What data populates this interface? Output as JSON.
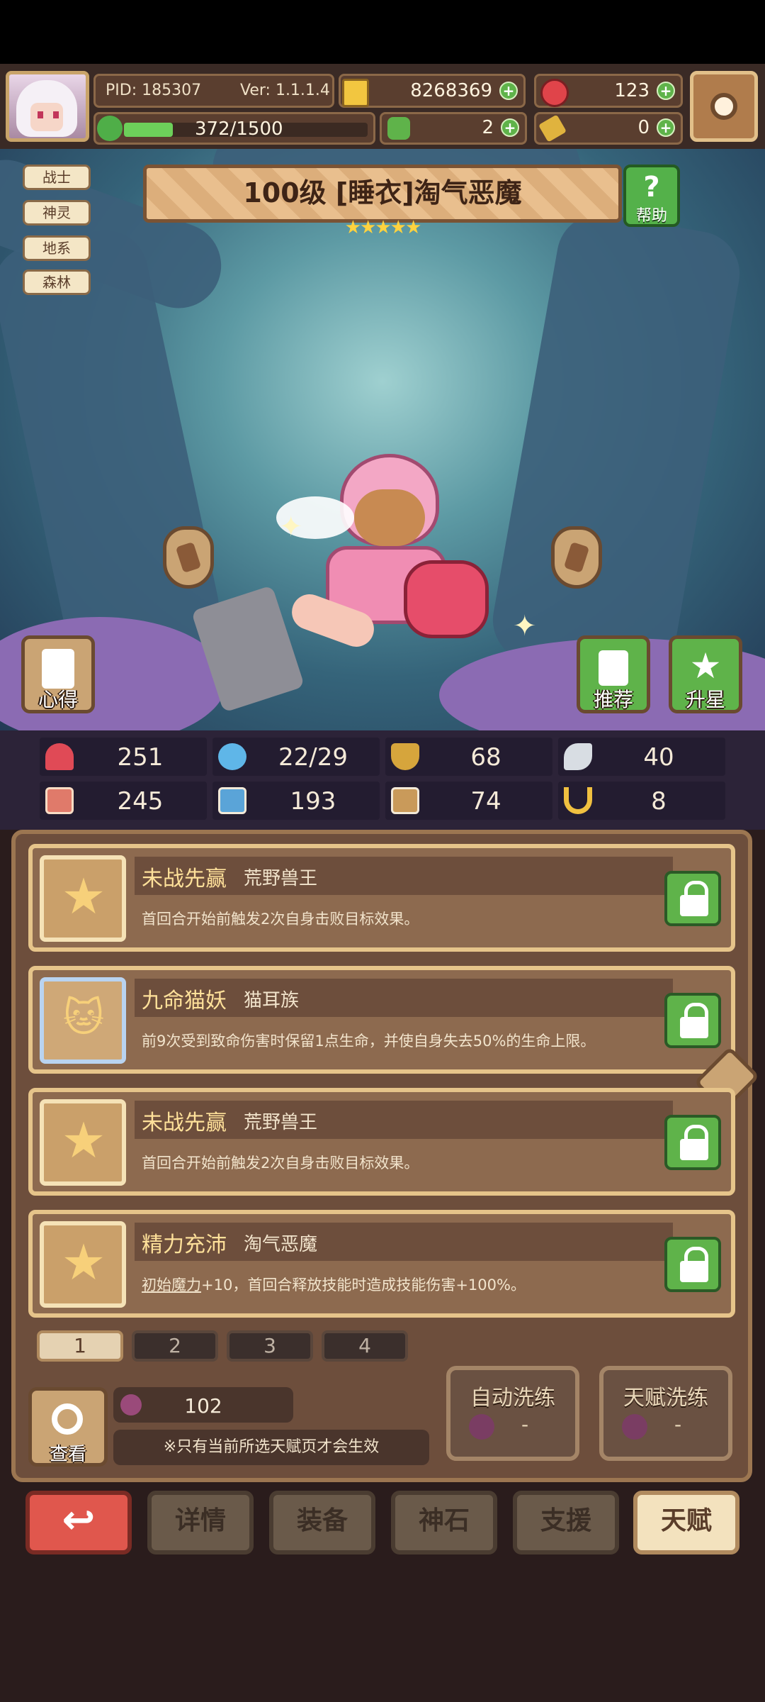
{
  "header": {
    "pid": "PID: 185307",
    "version": "Ver: 1.1.1.4",
    "gold": "8268369",
    "gems": "123",
    "exp": "372/1500",
    "clover": "2",
    "keys": "0"
  },
  "tags": [
    "战士",
    "神灵",
    "地系",
    "森林"
  ],
  "hero": {
    "title": "100级 [睡衣]淘气恶魔",
    "stars": "★★★★★",
    "help_label": "帮助"
  },
  "side_buttons": {
    "insight": "心得",
    "recommend": "推荐",
    "star_up": "升星"
  },
  "stats": [
    {
      "icon": "heart-icon",
      "value": "251",
      "color": "#e04a56"
    },
    {
      "icon": "mana-drop-icon",
      "value": "22/29",
      "color": "#5fb6e8"
    },
    {
      "icon": "armor-icon",
      "value": "68",
      "color": "#d6a53c"
    },
    {
      "icon": "wing-icon",
      "value": "40",
      "color": "#d8dde3"
    },
    {
      "icon": "fist-icon",
      "value": "245",
      "color": "#e07a6a"
    },
    {
      "icon": "book-icon",
      "value": "193",
      "color": "#5aa4d8"
    },
    {
      "icon": "boot-icon",
      "value": "74",
      "color": "#c99a5a"
    },
    {
      "icon": "horseshoe-icon",
      "value": "8",
      "color": "#f0c040"
    }
  ],
  "talents": [
    {
      "name": "未战先赢",
      "sub": "荒野兽王",
      "desc": "首回合开始前触发2次自身击败目标效果。"
    },
    {
      "name": "九命猫妖",
      "sub": "猫耳族",
      "desc": "前9次受到致命伤害时保留1点生命，并使自身失去50%的生命上限。"
    },
    {
      "name": "未战先赢",
      "sub": "荒野兽王",
      "desc": "首回合开始前触发2次自身击败目标效果。"
    },
    {
      "name": "精力充沛",
      "sub": "淘气恶魔",
      "desc_link": "初始魔力",
      "desc": "+10，首回合释放技能时造成技能伤害+100%。"
    }
  ],
  "pages": [
    "1",
    "2",
    "3",
    "4"
  ],
  "bottom_panel": {
    "view_label": "查看",
    "fruit_count": "102",
    "note": "※只有当前所选天赋页才会生效",
    "auto_refine": "自动洗练",
    "talent_refine": "天赋洗练",
    "dash": "-"
  },
  "nav": {
    "details": "详情",
    "equip": "装备",
    "stone": "神石",
    "support": "支援",
    "talent": "天赋"
  }
}
